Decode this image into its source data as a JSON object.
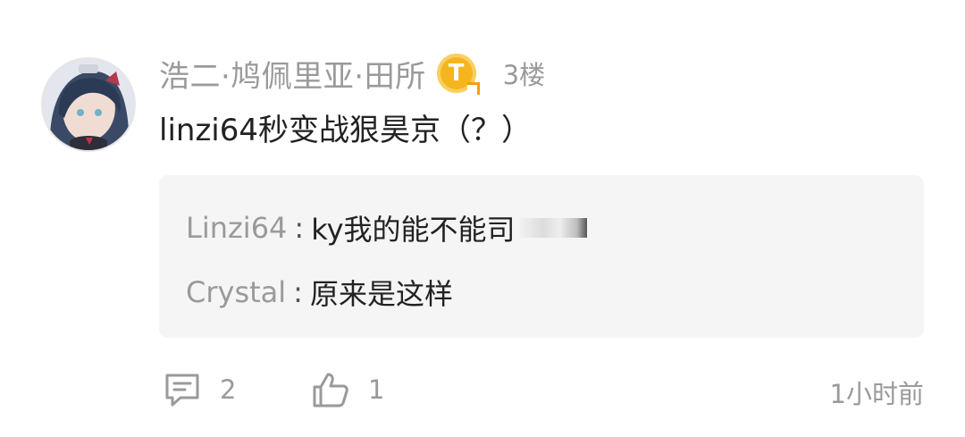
{
  "comment": {
    "author": "浩二·鸠佩里亚·田所",
    "badge_letter": "T",
    "floor": "3楼",
    "text": "linzi64秒变战狠昊京（？）",
    "replies": [
      {
        "user": "Linzi64",
        "separator": ":",
        "text": "ky我的能不能司"
      },
      {
        "user": "Crystal",
        "separator": ":",
        "text": "原来是这样"
      }
    ],
    "actions": {
      "reply_count": "2",
      "like_count": "1",
      "timestamp": "1小时前"
    }
  },
  "colors": {
    "meta_text": "#9a9a9a",
    "body_text": "#222222",
    "reply_bg": "#f5f5f5",
    "badge": "#f4b51e"
  }
}
